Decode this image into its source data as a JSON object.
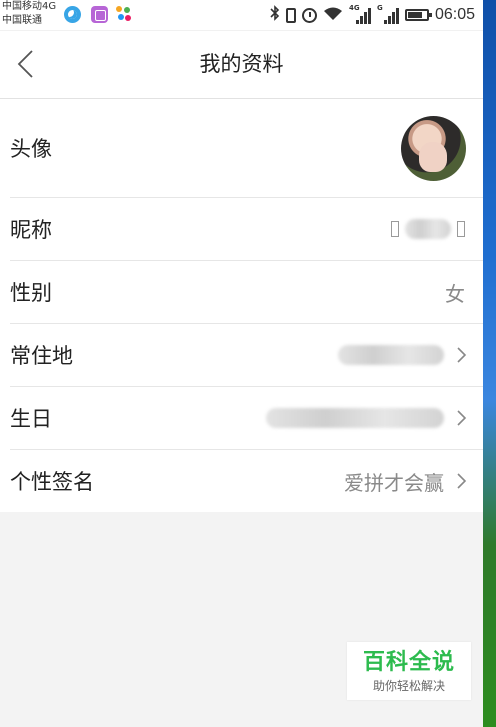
{
  "status_bar": {
    "carrier_line1": "中国移动4G",
    "carrier_line2": "中国联通",
    "signal1_tag": "4G",
    "signal2_tag": "G",
    "time": "06:05",
    "battery_level": 0.75
  },
  "header": {
    "title": "我的资料"
  },
  "profile_rows": [
    {
      "label": "头像"
    },
    {
      "label": "昵称"
    },
    {
      "label": "性别",
      "value": "女"
    },
    {
      "label": "常住地"
    },
    {
      "label": "生日"
    },
    {
      "label": "个性签名",
      "value": "爱拼才会赢"
    }
  ],
  "watermark": {
    "title": "百科全说",
    "subtitle": "助你轻松解决"
  },
  "colors": {
    "watermark_green": "#2dbb4e",
    "value_gray": "#8a8a8a"
  }
}
